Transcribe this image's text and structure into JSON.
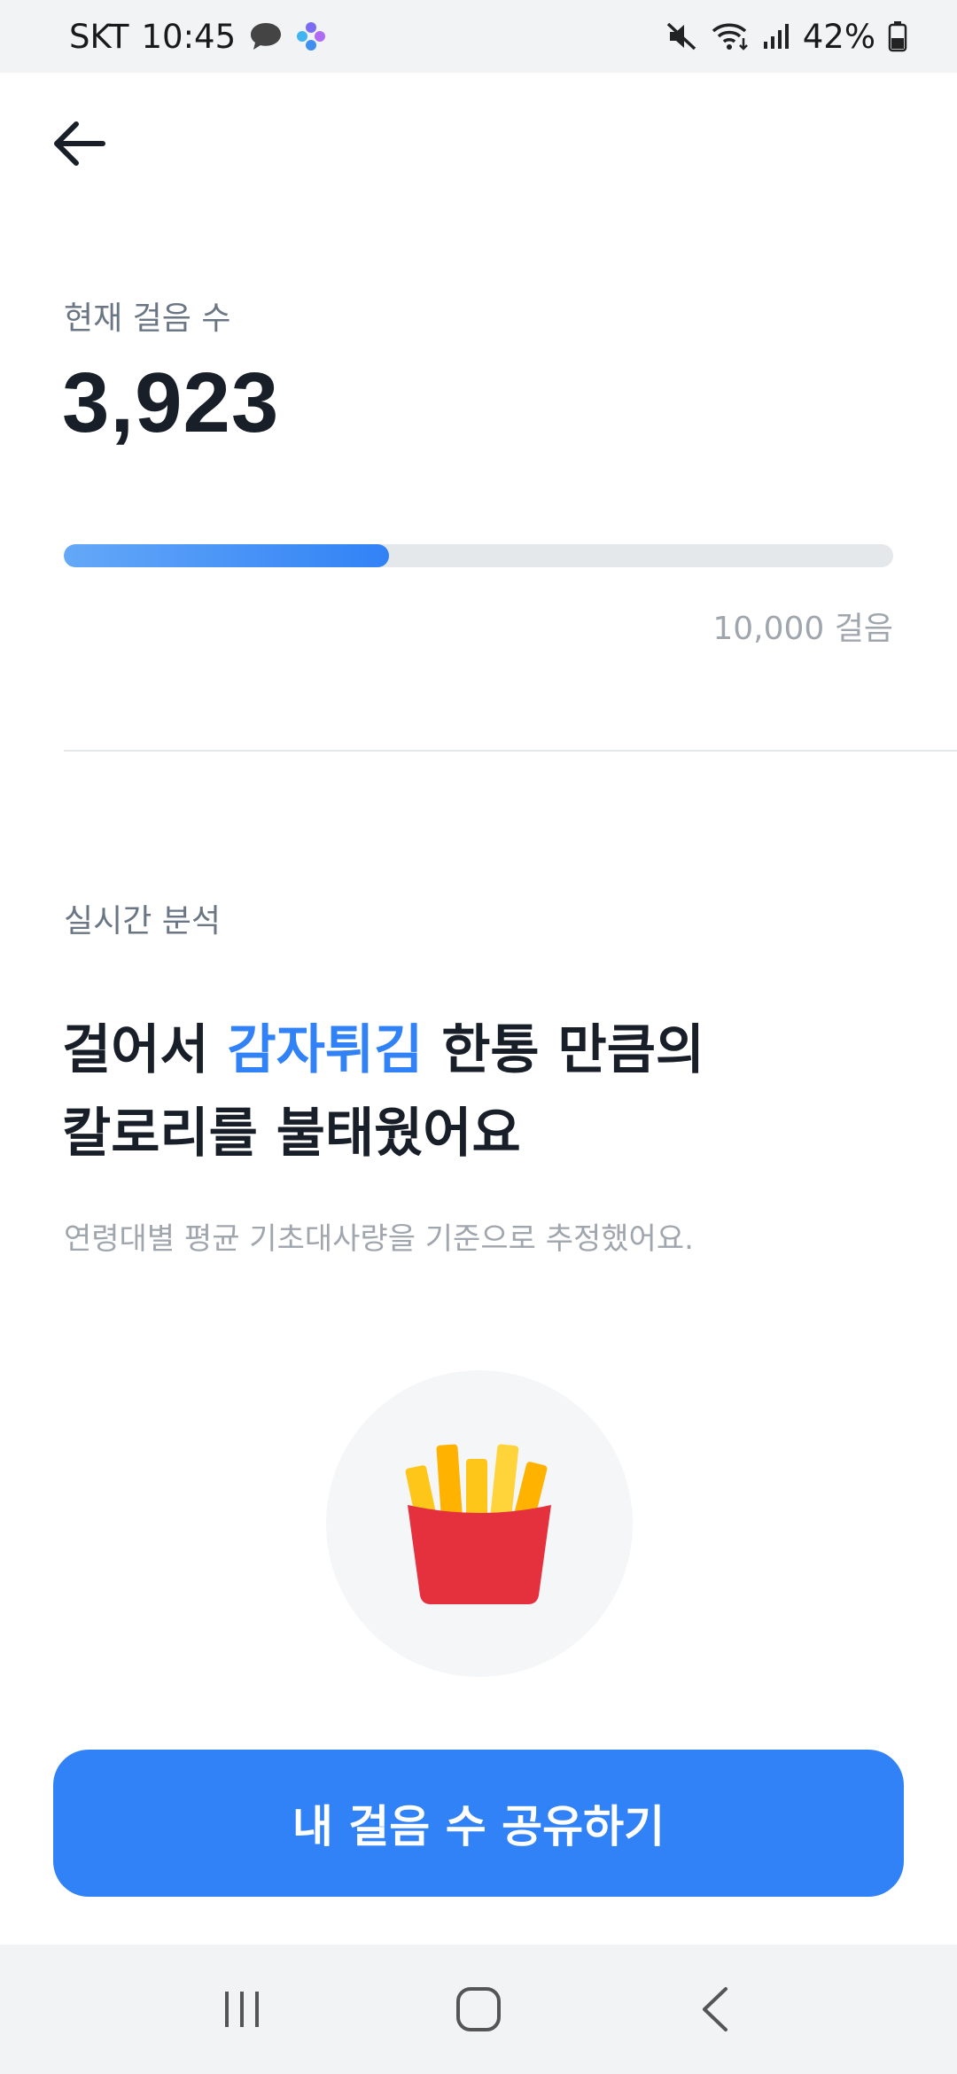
{
  "status_bar": {
    "carrier": "SKT",
    "time": "10:45",
    "battery": "42%",
    "icons": [
      "chat-bubble-icon",
      "app-sparkle-icon",
      "mute-icon",
      "wifi-icon",
      "signal-icon",
      "battery-icon"
    ]
  },
  "header": {
    "back_icon": "arrow-left-icon"
  },
  "steps": {
    "label": "현재 걸음 수",
    "value": "3,923",
    "progress_fraction": 0.3923,
    "goal_label": "10,000 걸음"
  },
  "analysis": {
    "section_label": "실시간 분석",
    "headline_prefix": "걸어서 ",
    "headline_accent": "감자튀김",
    "headline_suffix": " 한통 만큼의",
    "headline_line2": "칼로리를 불태웠어요",
    "caption": "연령대별 평균 기초대사량을 기준으로 추정했어요.",
    "illustration": "french-fries-icon"
  },
  "share_button": {
    "label": "내 걸음 수 공유하기"
  },
  "nav_bar": {
    "items": [
      "recent-apps-icon",
      "home-icon",
      "back-icon"
    ]
  },
  "colors": {
    "accent": "#3182f6",
    "text_primary": "#191f28",
    "text_secondary": "#6b7684",
    "text_muted": "#a0a6ad",
    "fries_box": "#e5303e",
    "fries": "#ffc61a"
  }
}
